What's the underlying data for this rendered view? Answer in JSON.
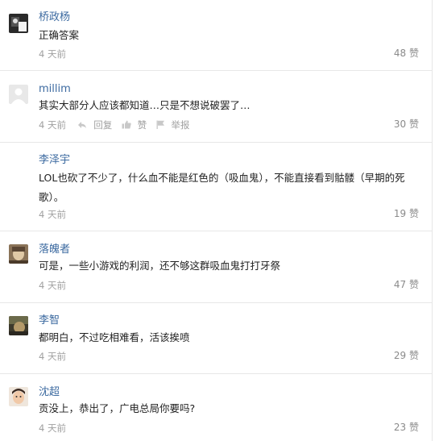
{
  "comments": [
    {
      "user": "桥政杨",
      "text": "正确答案",
      "time": "4 天前",
      "likes": "48 赞",
      "avatar_icon": "avatar-icon",
      "show_actions": false
    },
    {
      "user": "millim",
      "text": "其实大部分人应该都知道…只是不想说破罢了…",
      "time": "4 天前",
      "likes": "30 赞",
      "avatar_icon": "default-avatar-icon",
      "show_actions": true
    },
    {
      "user": "李泽宇",
      "text": "LOL也砍了不少了，什么血不能是红色的（吸血鬼），不能直接看到骷髅（早期的死歌）。",
      "time": "4 天前",
      "likes": "19 赞",
      "avatar_icon": "none",
      "show_actions": false
    },
    {
      "user": "落魄者",
      "text": "可是，一些小游戏的利润，还不够这群吸血鬼打打牙祭",
      "time": "4 天前",
      "likes": "47 赞",
      "avatar_icon": "avatar-icon",
      "show_actions": false
    },
    {
      "user": "李智",
      "text": "都明白，不过吃相难看，活该挨喷",
      "time": "4 天前",
      "likes": "29 赞",
      "avatar_icon": "avatar-icon",
      "show_actions": false
    },
    {
      "user": "沈超",
      "text": "贡没上，恭出了，广电总局你要吗?",
      "time": "4 天前",
      "likes": "23 赞",
      "avatar_icon": "avatar-icon",
      "show_actions": false
    }
  ],
  "actions": {
    "reply": "回复",
    "like": "赞",
    "report": "举报"
  },
  "colors": {
    "username": "#3c6aa0",
    "text": "#222222",
    "meta": "#a0a0a0",
    "divider": "#e7e7e7"
  }
}
